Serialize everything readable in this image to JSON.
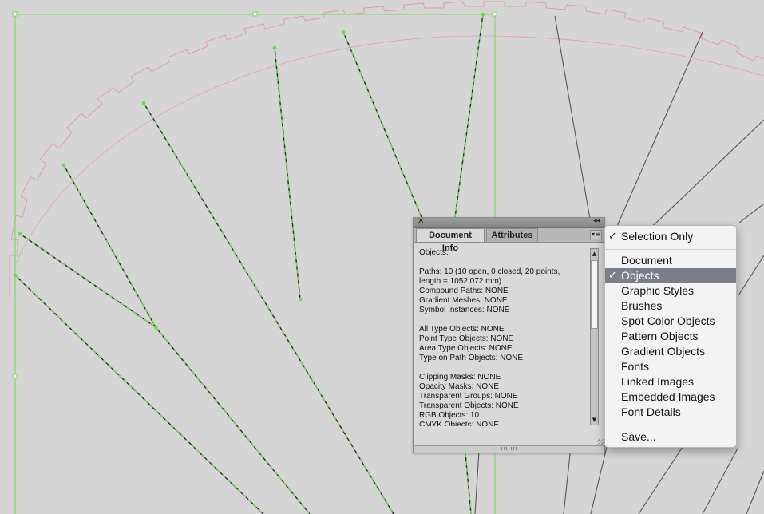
{
  "canvas": {
    "background": "#d5d5d5",
    "selection_color": "#6bdc4d",
    "guide_color": "#e89a9a",
    "line_color": "#555555"
  },
  "panel": {
    "close_icon": "close-icon",
    "collapse_icon": "double-chevron-left-icon",
    "tabs": [
      {
        "label": "Document Info",
        "active": true
      },
      {
        "label": "Attributes",
        "active": false
      }
    ],
    "menu_icon": "panel-menu-icon",
    "info_lines": [
      "Objects:",
      "",
      "Paths: 10 (10 open, 0 closed, 20 points,",
      "length = 1052.072 mm)",
      "Compound Paths: NONE",
      "Gradient Meshes: NONE",
      "Symbol Instances: NONE",
      "",
      "All Type Objects: NONE",
      "Point Type Objects: NONE",
      "Area Type Objects: NONE",
      "Type on Path Objects: NONE",
      "",
      "Clipping Masks: NONE",
      "Opacity Masks: NONE",
      "Transparent Groups: NONE",
      "Transparent Objects: NONE",
      "RGB Objects: 10",
      "CMYK Objects: NONE"
    ]
  },
  "menu": {
    "items": [
      {
        "label": "Selection Only",
        "checked": true,
        "highlighted": false
      },
      {
        "label": "Document",
        "checked": false,
        "highlighted": false
      },
      {
        "label": "Objects",
        "checked": true,
        "highlighted": true
      },
      {
        "label": "Graphic Styles",
        "checked": false,
        "highlighted": false
      },
      {
        "label": "Brushes",
        "checked": false,
        "highlighted": false
      },
      {
        "label": "Spot Color Objects",
        "checked": false,
        "highlighted": false
      },
      {
        "label": "Pattern Objects",
        "checked": false,
        "highlighted": false
      },
      {
        "label": "Gradient Objects",
        "checked": false,
        "highlighted": false
      },
      {
        "label": "Fonts",
        "checked": false,
        "highlighted": false
      },
      {
        "label": "Linked Images",
        "checked": false,
        "highlighted": false
      },
      {
        "label": "Embedded Images",
        "checked": false,
        "highlighted": false
      },
      {
        "label": "Font Details",
        "checked": false,
        "highlighted": false
      },
      {
        "label": "Save...",
        "checked": false,
        "highlighted": false
      }
    ],
    "check_glyph": "✓"
  }
}
